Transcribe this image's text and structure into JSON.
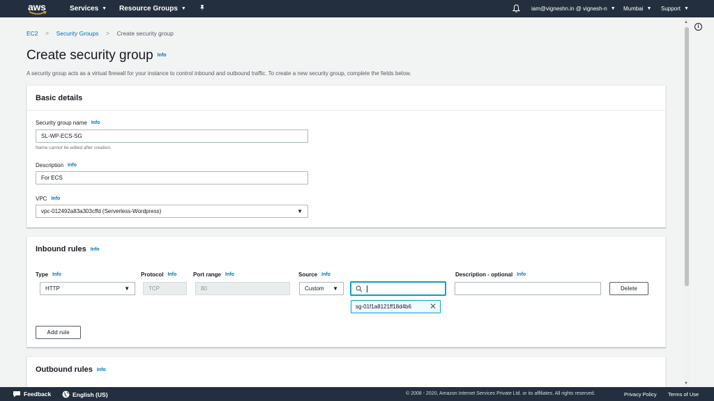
{
  "nav": {
    "logo": "aws",
    "services": "Services",
    "resource_groups": "Resource Groups",
    "pin_icon": "pin-icon",
    "bell_icon": "bell-icon",
    "account": "iam@vigneshn.in @ vignesh-n",
    "region": "Mumbai",
    "support": "Support"
  },
  "breadcrumb": {
    "items": [
      "EC2",
      "Security Groups",
      "Create security group"
    ]
  },
  "page": {
    "title": "Create security group",
    "info": "Info",
    "description": "A security group acts as a virtual firewall for your instance to control inbound and outbound traffic. To create a new security group, complete the fields below."
  },
  "basic_details": {
    "header": "Basic details",
    "name_label": "Security group name",
    "name_info": "Info",
    "name_value": "SL-WP-ECS-SG",
    "name_hint": "Name cannot be edited after creation.",
    "desc_label": "Description",
    "desc_info": "Info",
    "desc_value": "For ECS",
    "vpc_label": "VPC",
    "vpc_info": "Info",
    "vpc_value": "vpc-012492a83a303cffd (Serverless-Wordpress)"
  },
  "inbound": {
    "header": "Inbound rules",
    "info": "Info",
    "col_type": "Type",
    "col_protocol": "Protocol",
    "col_port": "Port range",
    "col_source": "Source",
    "col_desc": "Description - optional",
    "col_info": "Info",
    "row": {
      "type": "HTTP",
      "protocol": "TCP",
      "port": "80",
      "source": "Custom",
      "search_value": "",
      "token": "sg-01f1a8121ff18d4b6",
      "description": ""
    },
    "delete_button": "Delete",
    "add_rule_button": "Add rule"
  },
  "outbound": {
    "header": "Outbound rules",
    "info": "Info"
  },
  "footer": {
    "feedback": "Feedback",
    "language": "English (US)",
    "copyright": "© 2008 - 2020, Amazon Internet Services Private Ltd. or its affiliates. All rights reserved.",
    "privacy": "Privacy Policy",
    "terms": "Terms of Use"
  },
  "colors": {
    "nav_bg": "#232f3e",
    "link": "#0073bb",
    "focus": "#00a1c9",
    "page_bg": "#f2f3f3"
  }
}
